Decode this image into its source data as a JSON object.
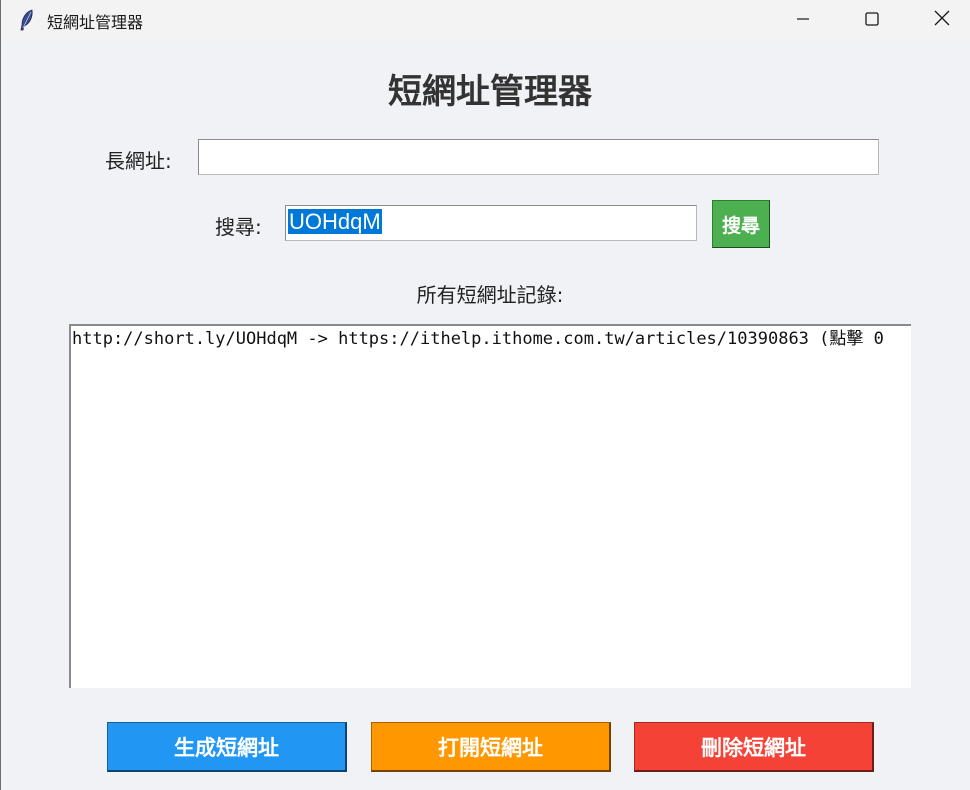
{
  "window": {
    "title": "短網址管理器"
  },
  "heading": "短網址管理器",
  "long_url": {
    "label": "長網址:",
    "value": ""
  },
  "search": {
    "label": "搜尋:",
    "value": "UOHdqM",
    "button_label": "搜尋"
  },
  "records": {
    "label": "所有短網址記錄:",
    "items": [
      "http://short.ly/UOHdqM -> https://ithelp.ithome.com.tw/articles/10390863 (點擊 0"
    ]
  },
  "actions": {
    "generate_label": "生成短網址",
    "open_label": "打開短網址",
    "delete_label": "刪除短網址"
  },
  "colors": {
    "search_button": "#4caf50",
    "generate_button": "#2196f3",
    "open_button": "#ff9800",
    "delete_button": "#f44336",
    "background": "#f0f2f5"
  },
  "icons": {
    "app": "feather-icon",
    "minimize": "minimize-icon",
    "maximize": "maximize-icon",
    "close": "close-icon"
  }
}
